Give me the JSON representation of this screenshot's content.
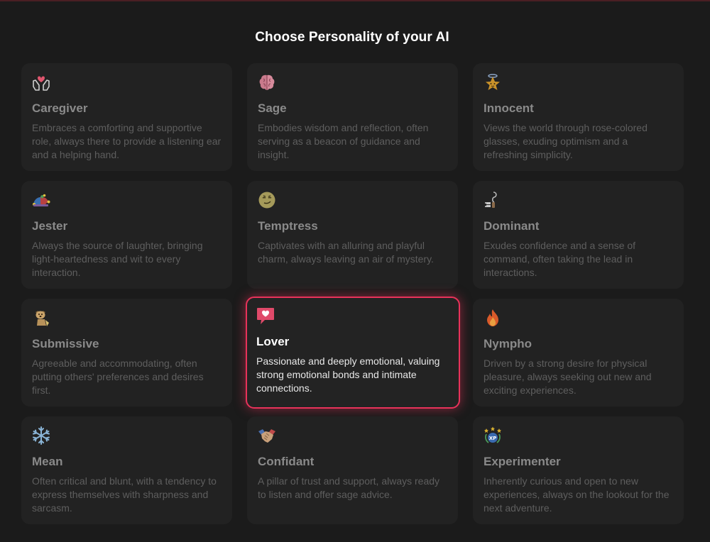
{
  "page": {
    "title": "Choose Personality of your AI"
  },
  "colors": {
    "background": "#1b1b1b",
    "card": "#222222",
    "accent": "#e8325a",
    "title_muted": "#8a8a8a",
    "desc_muted": "#5e5e5e"
  },
  "personalities": [
    {
      "icon": "heart-hands-icon",
      "title": "Caregiver",
      "description": "Embraces a comforting and supportive role, always there to provide a listening ear and a helping hand.",
      "selected": false
    },
    {
      "icon": "brain-icon",
      "title": "Sage",
      "description": "Embodies wisdom and reflection, often serving as a beacon of guidance and insight.",
      "selected": false
    },
    {
      "icon": "star-icon",
      "title": "Innocent",
      "description": "Views the world through rose-colored glasses, exuding optimism and a refreshing simplicity.",
      "selected": false
    },
    {
      "icon": "jester-hat-icon",
      "title": "Jester",
      "description": "Always the source of laughter, bringing light-heartedness and wit to every interaction.",
      "selected": false
    },
    {
      "icon": "smirk-face-icon",
      "title": "Temptress",
      "description": "Captivates with an alluring and playful charm, always leaving an air of mystery.",
      "selected": false
    },
    {
      "icon": "whip-icon",
      "title": "Dominant",
      "description": "Exudes confidence and a sense of command, often taking the lead in interactions.",
      "selected": false
    },
    {
      "icon": "dog-icon",
      "title": "Submissive",
      "description": "Agreeable and accommodating, often putting others' preferences and desires first.",
      "selected": false
    },
    {
      "icon": "heart-speech-bubble-icon",
      "title": "Lover",
      "description": "Passionate and deeply emotional, valuing strong emotional bonds and intimate connections.",
      "selected": true
    },
    {
      "icon": "fire-icon",
      "title": "Nympho",
      "description": "Driven by a strong desire for physical pleasure, always seeking out new and exciting experiences.",
      "selected": false
    },
    {
      "icon": "snowflake-icon",
      "title": "Mean",
      "description": "Often critical and blunt, with a tendency to express themselves with sharpness and sarcasm.",
      "selected": false
    },
    {
      "icon": "handshake-icon",
      "title": "Confidant",
      "description": "A pillar of trust and support, always ready to listen and offer sage advice.",
      "selected": false
    },
    {
      "icon": "xp-badge-icon",
      "title": "Experimenter",
      "description": "Inherently curious and open to new experiences, always on the lookout for the next adventure.",
      "selected": false
    }
  ]
}
